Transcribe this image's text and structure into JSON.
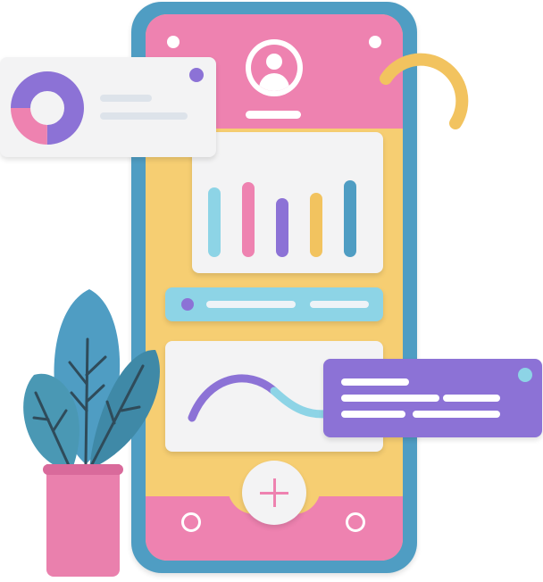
{
  "colors": {
    "phone_frame": "#4f9dc3",
    "screen_background": "#f6ce72",
    "pink_accent": "#ee82b0",
    "purple_accent": "#8c72d6",
    "cyan_accent": "#8dd4e6",
    "yellow_accent": "#f2c35f",
    "leaf_teal": "#4a98b4",
    "pot_pink": "#ea80ad",
    "card_background": "#f3f3f4"
  },
  "icons": {
    "profile": "user-avatar-icon",
    "add": "plus-icon",
    "nav_left": "circle-nav-icon",
    "nav_right": "circle-nav-icon",
    "donut_chart": "donut-chart-icon",
    "bar_chart": "bar-chart-icon",
    "wave_chart": "wave-line-icon",
    "arc_decoration": "arc-icon",
    "plant": "potted-plant-icon"
  },
  "bar_chart": {
    "levels": [
      0.78,
      0.84,
      0.66,
      0.72,
      0.86
    ],
    "colors": [
      "#8dd4e6",
      "#ee82b0",
      "#8c72d6",
      "#f2c35f",
      "#4f9dc3"
    ]
  },
  "donut": {
    "segments": [
      {
        "fraction": 0.75,
        "color": "#8c72d6"
      },
      {
        "fraction": 0.25,
        "color": "#ee82b0"
      }
    ]
  }
}
